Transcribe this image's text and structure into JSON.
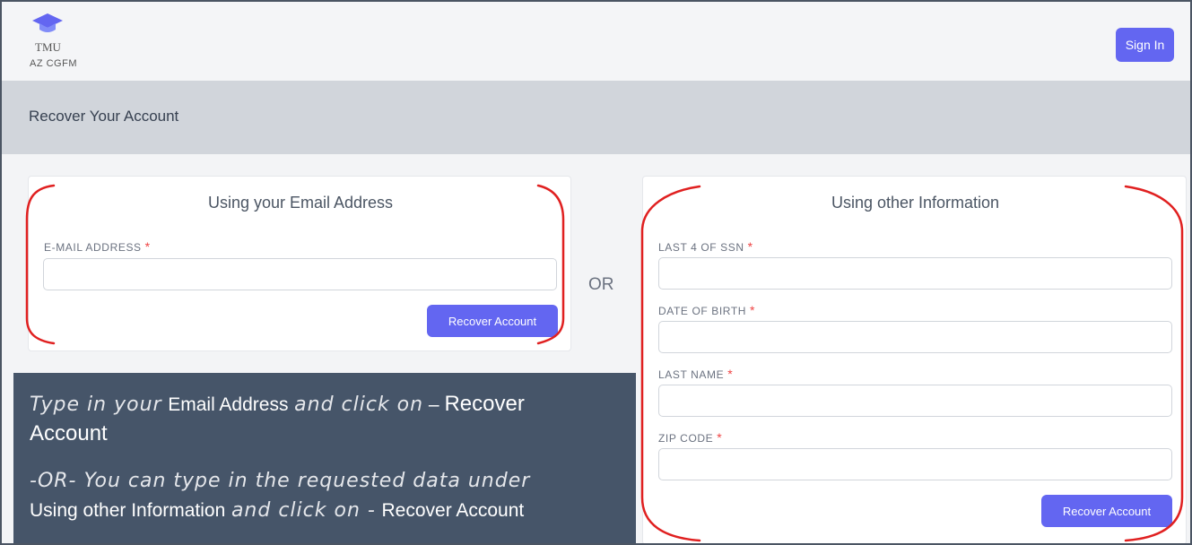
{
  "header": {
    "logo_name": "TMU",
    "logo_sub": "AZ CGFM",
    "sign_in_label": "Sign In"
  },
  "page_title": "Recover Your Account",
  "email_card": {
    "heading": "Using your Email Address",
    "email_label": "E-MAIL ADDRESS",
    "email_value": "",
    "button_label": "Recover Account"
  },
  "separator": "OR",
  "other_card": {
    "heading": "Using other Information",
    "ssn_label": "LAST 4 OF SSN",
    "ssn_value": "",
    "dob_label": "DATE OF BIRTH",
    "dob_value": "",
    "last_name_label": "LAST NAME",
    "last_name_value": "",
    "zip_label": "ZIP CODE",
    "zip_value": "",
    "button_label": "Recover Account"
  },
  "required_marker": "*",
  "instructions": {
    "line1_italic": "Type in your",
    "line1_bold": "Email Address",
    "line1_italic2": "and click on",
    "line1_dash": " – ",
    "line1_end": "Recover",
    "line2": "Account",
    "line3_italic": "-OR- You can type in the requested data under",
    "line4_bold": "Using other Information",
    "line4_italic": "and click on -",
    "line4_end": "Recover Account"
  },
  "colors": {
    "accent": "#6366f1",
    "required": "#ef4444",
    "annotation": "#e02020",
    "note_bg": "#465569"
  }
}
